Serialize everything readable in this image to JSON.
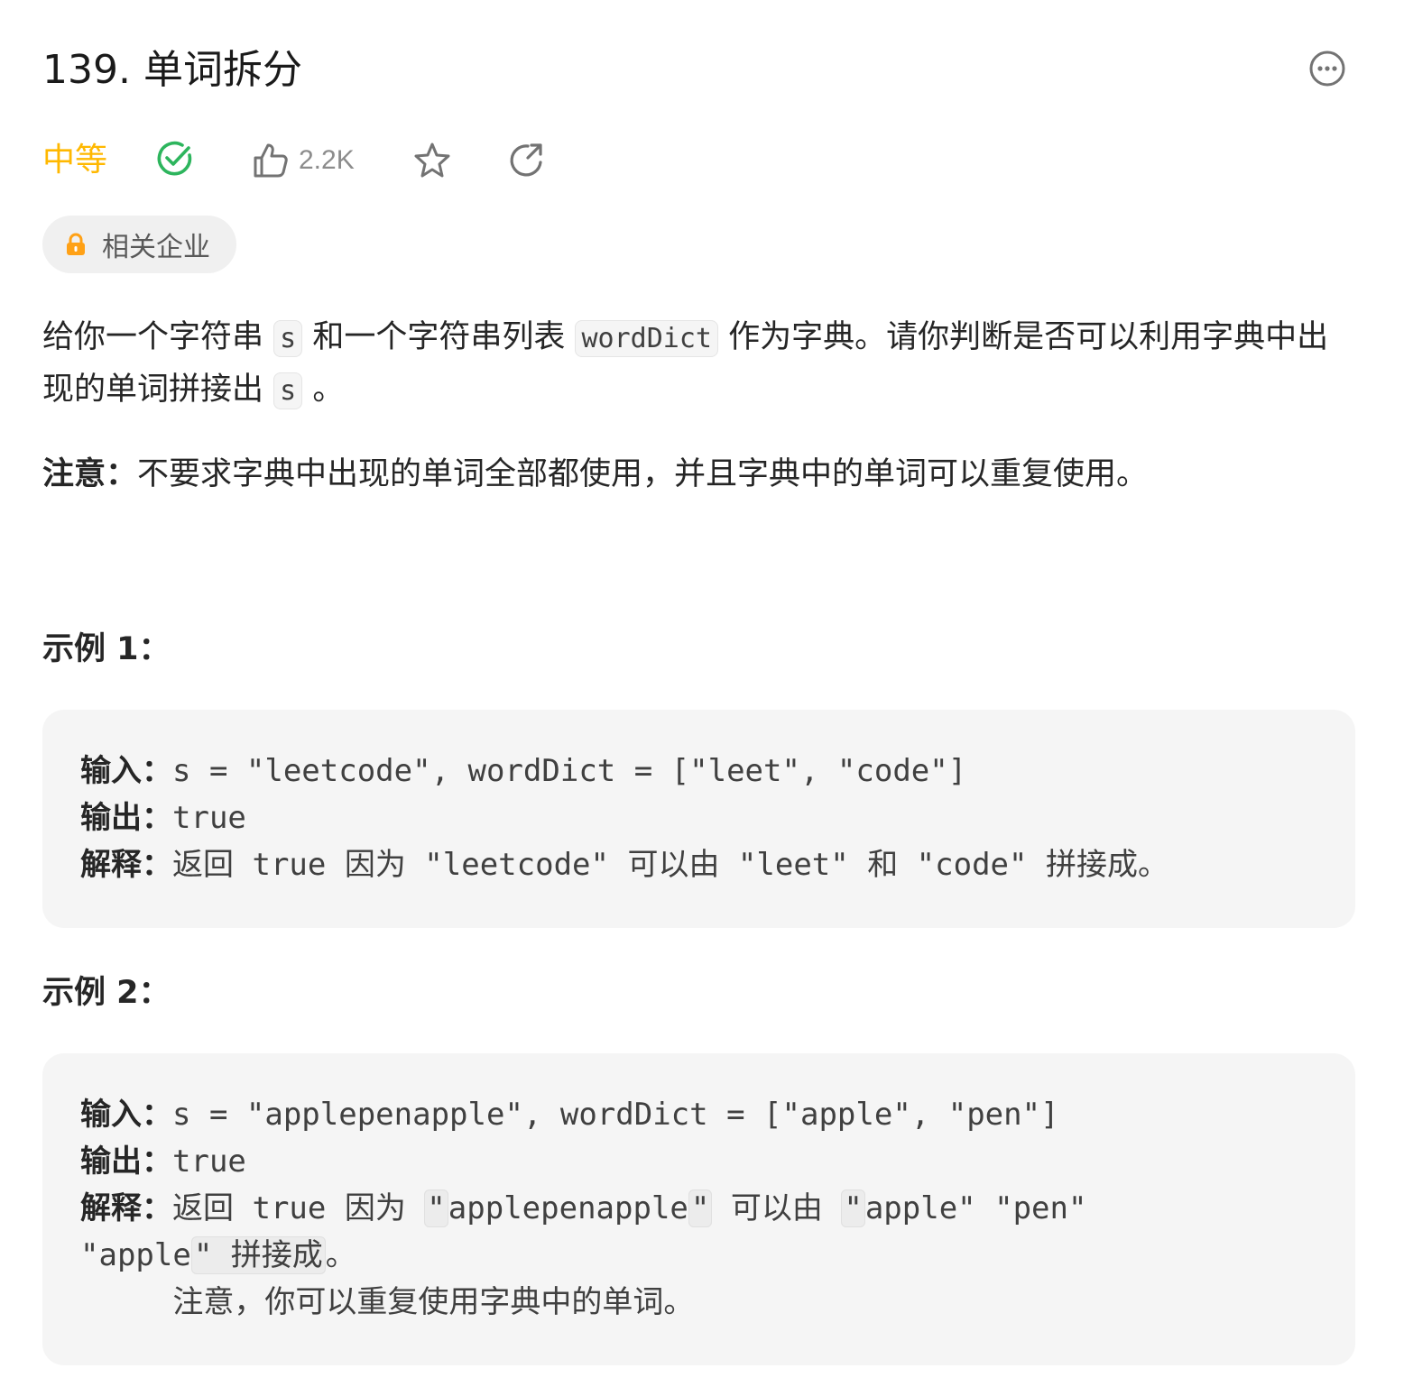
{
  "title": "139. 单词拆分",
  "meta": {
    "difficulty": "中等",
    "likes": "2.2K",
    "difficulty_color": "#ffb800",
    "solved_icon": "check-circle-icon",
    "star_icon": "star-icon",
    "share_icon": "share-icon"
  },
  "companies": {
    "label": "相关企业"
  },
  "description": {
    "p1_a": "给你一个字符串 ",
    "p1_code1": "s",
    "p1_b": " 和一个字符串列表 ",
    "p1_code2": "wordDict",
    "p1_c": " 作为字典。请你判断是否可以利用字典中出现的单词拼接出 ",
    "p1_code3": "s",
    "p1_d": " 。",
    "note_label": "注意：",
    "note_text": "不要求字典中出现的单词全部都使用，并且字典中的单词可以重复使用。"
  },
  "examples": [
    {
      "title": "示例 1：",
      "input_label": "输入：",
      "input": "s = \"leetcode\", wordDict = [\"leet\", \"code\"]",
      "output_label": "输出：",
      "output": "true",
      "explain_label": "解释：",
      "explain": "返回 true 因为 \"leetcode\" 可以由 \"leet\" 和 \"code\" 拼接成。"
    },
    {
      "title": "示例 2：",
      "input_label": "输入：",
      "input": "s = \"applepenapple\", wordDict = [\"apple\", \"pen\"]",
      "output_label": "输出：",
      "output": "true",
      "explain_label": "解释：",
      "explain_a": "返回 true 因为 ",
      "explain_q1": "\"",
      "explain_b": "applepenapple",
      "explain_q2": "\"",
      "explain_c": " 可以由 ",
      "explain_q3": "\"",
      "explain_d": "apple\" \"pen\"",
      "explain_line2_a": "\"apple",
      "explain_line2_code": "\" 拼接成",
      "explain_line2_b": "。",
      "explain_line3": "     注意，你可以重复使用字典中的单词。"
    }
  ]
}
